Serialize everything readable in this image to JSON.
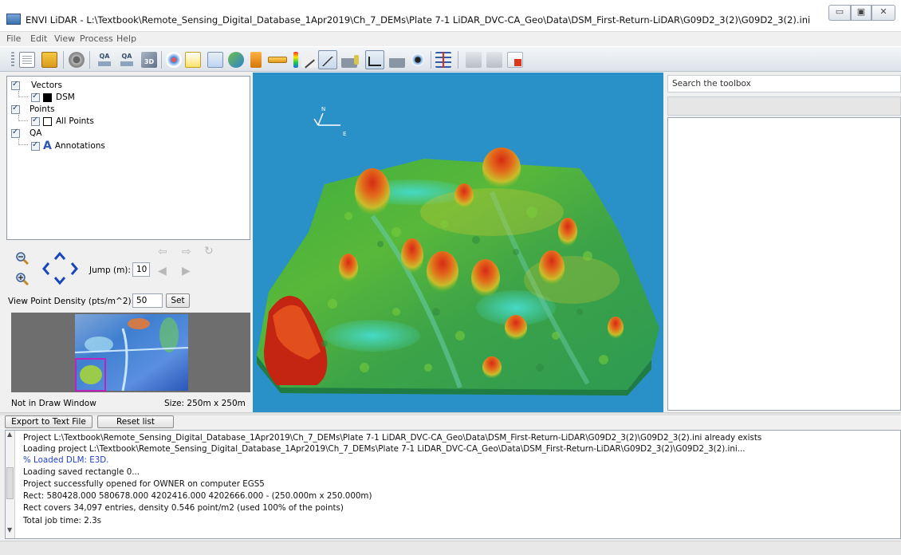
{
  "window": {
    "title": "ENVI LiDAR - L:\\Textbook\\Remote_Sensing_Digital_Database_1Apr2019\\Ch_7_DEMs\\Plate 7-1 LiDAR_DVC-CA_Geo\\Data\\DSM_First-Return-LiDAR\\G09D2_3(2)\\G09D2_3(2).ini",
    "minimize_glyph": "▭",
    "maximize_glyph": "▣",
    "close_glyph": "✕"
  },
  "menu": [
    "File",
    "Edit",
    "View",
    "Process",
    "Help"
  ],
  "toolbar": {
    "qa1": "QA",
    "qa2": "QA",
    "threed": "3D"
  },
  "layers": {
    "vectors": "Vectors",
    "dsm": "DSM",
    "points": "Points",
    "all_points": "All Points",
    "qa": "QA",
    "annotations": "Annotations"
  },
  "compass": {
    "north": "N",
    "east": "E"
  },
  "navigation": {
    "jump_label": "Jump (m):",
    "jump_value": "10",
    "density_label": "View Point Density (pts/m^2):",
    "density_value": "50",
    "set_label": "Set"
  },
  "status": {
    "draw_window": "Not in Draw Window",
    "size": "Size: 250m x 250m"
  },
  "toolbox": {
    "search_placeholder": "Search the toolbox"
  },
  "log": {
    "export_label": "Export to Text File",
    "reset_label": "Reset list",
    "lines": [
      "Project L:\\Textbook\\Remote_Sensing_Digital_Database_1Apr2019\\Ch_7_DEMs\\Plate 7-1 LiDAR_DVC-CA_Geo\\Data\\DSM_First-Return-LiDAR\\G09D2_3(2)\\G09D2_3(2).ini already exists",
      "Loading project L:\\Textbook\\Remote_Sensing_Digital_Database_1Apr2019\\Ch_7_DEMs\\Plate 7-1 LiDAR_DVC-CA_Geo\\Data\\DSM_First-Return-LiDAR\\G09D2_3(2)\\G09D2_3(2).ini...",
      "% Loaded DLM: E3D.",
      "Loading saved rectangle 0...",
      "Project successfully opened for OWNER on computer EGS5",
      "Rect: 580428.000 580678.000 4202416.000 4202666.000 - (250.000m x 250.000m)",
      "Rect covers 34,097 entries, density 0.546 point/m2 (used 100% of the points)",
      "Total job time:  2.3s"
    ]
  }
}
